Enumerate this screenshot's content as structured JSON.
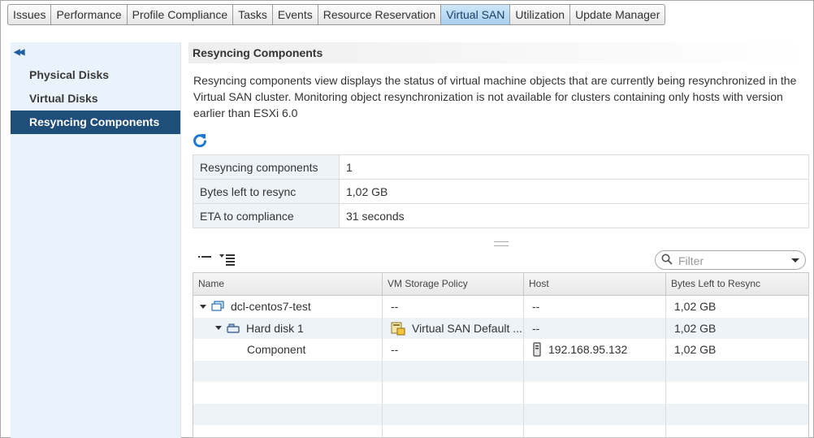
{
  "tabs": [
    "Issues",
    "Performance",
    "Profile Compliance",
    "Tasks",
    "Events",
    "Resource Reservation",
    "Virtual SAN",
    "Utilization",
    "Update Manager"
  ],
  "active_tab": "Virtual SAN",
  "sidebar": {
    "collapse_icon": "double-chevron-left-icon",
    "items": [
      {
        "label": "Physical Disks"
      },
      {
        "label": "Virtual Disks"
      },
      {
        "label": "Resyncing Components"
      }
    ],
    "active": "Resyncing Components"
  },
  "main": {
    "title": "Resyncing Components",
    "description": "Resyncing components view displays the status of virtual machine objects that are currently being resynchronized in the Virtual SAN cluster. Monitoring object resynchronization is not available for clusters containing only hosts with version earlier than ESXi 6.0",
    "summary": [
      {
        "key": "Resyncing components",
        "value": "1"
      },
      {
        "key": "Bytes left to resync",
        "value": "1,02 GB"
      },
      {
        "key": "ETA to compliance",
        "value": "31 seconds"
      }
    ],
    "filter_placeholder": "Filter",
    "grid": {
      "columns": [
        "Name",
        "VM Storage Policy",
        "Host",
        "Bytes Left to Resync"
      ],
      "rows": [
        {
          "name": "dcl-centos7-test",
          "policy": "--",
          "host": "--",
          "bytes": "1,02 GB"
        },
        {
          "name": "Hard disk 1",
          "policy": "Virtual SAN Default ...",
          "host": "--",
          "bytes": "1,02 GB"
        },
        {
          "name": "Component",
          "policy": "--",
          "host": "192.168.95.132",
          "bytes": "1,02 GB"
        }
      ]
    }
  },
  "colors": {
    "active_tab": "#a9d0ef",
    "sidebar_bg": "#eaf3fb",
    "sidebar_active": "#1f4e7a",
    "refresh": "#1f78d1"
  }
}
